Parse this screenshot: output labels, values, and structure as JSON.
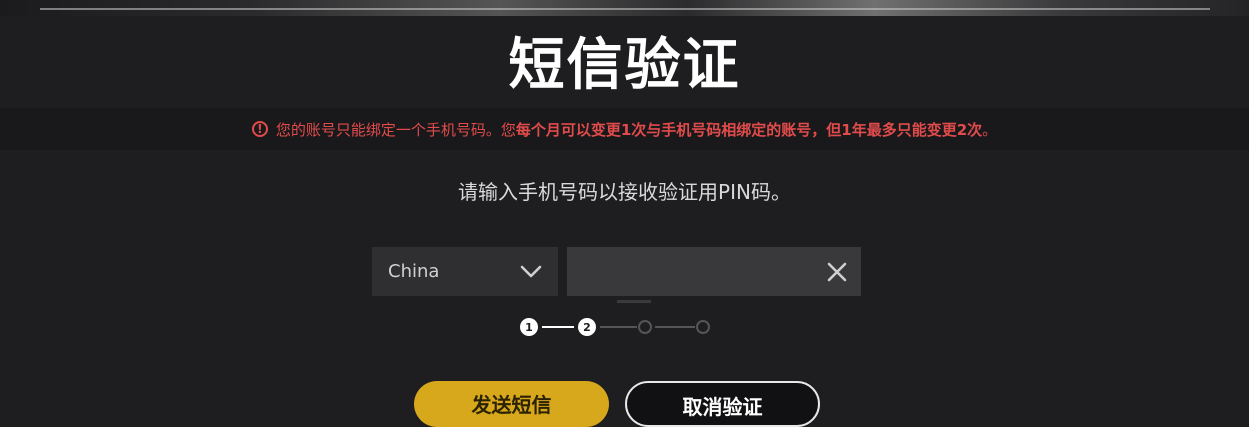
{
  "page": {
    "title": "短信验证"
  },
  "warning": {
    "icon": "exclamation-circle-icon",
    "text_normal": "您的账号只能绑定一个手机号码。您",
    "text_bold": "每个月可以变更1次与手机号码相绑定的账号，但1年最多只能变更2次",
    "text_end": "。",
    "color": "#e14b4b"
  },
  "instruction": "请输入手机号码以接收验证用PIN码。",
  "form": {
    "country_selected": "China",
    "country_icon": "chevron-down-icon",
    "phone_value": "",
    "clear_icon": "close-icon"
  },
  "stepper": {
    "steps": [
      "1",
      "2",
      "",
      ""
    ],
    "current": 2,
    "total": 4
  },
  "buttons": {
    "send_sms": "发送短信",
    "cancel": "取消验证"
  },
  "colors": {
    "accent": "#d7a71c",
    "background": "#1e1e20"
  }
}
